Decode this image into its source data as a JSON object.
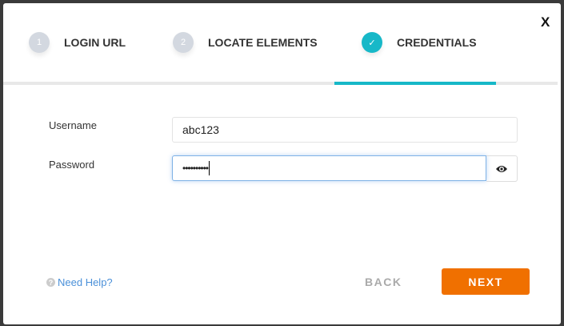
{
  "dialog": {
    "close_label": "X"
  },
  "steps": [
    {
      "number": "1",
      "label": "LOGIN URL"
    },
    {
      "number": "2",
      "label": "LOCATE ELEMENTS"
    },
    {
      "number": "✓",
      "label": "CREDENTIALS"
    }
  ],
  "active_step": 3,
  "form": {
    "username_label": "Username",
    "username_value": "abc123",
    "password_label": "Password",
    "password_masked": "••••••••••"
  },
  "footer": {
    "help_icon": "?",
    "help_label": "Need Help?",
    "back_label": "BACK",
    "next_label": "NEXT"
  },
  "colors": {
    "accent": "#17b8c8",
    "primary_button": "#f07000",
    "link": "#4a90d9"
  }
}
